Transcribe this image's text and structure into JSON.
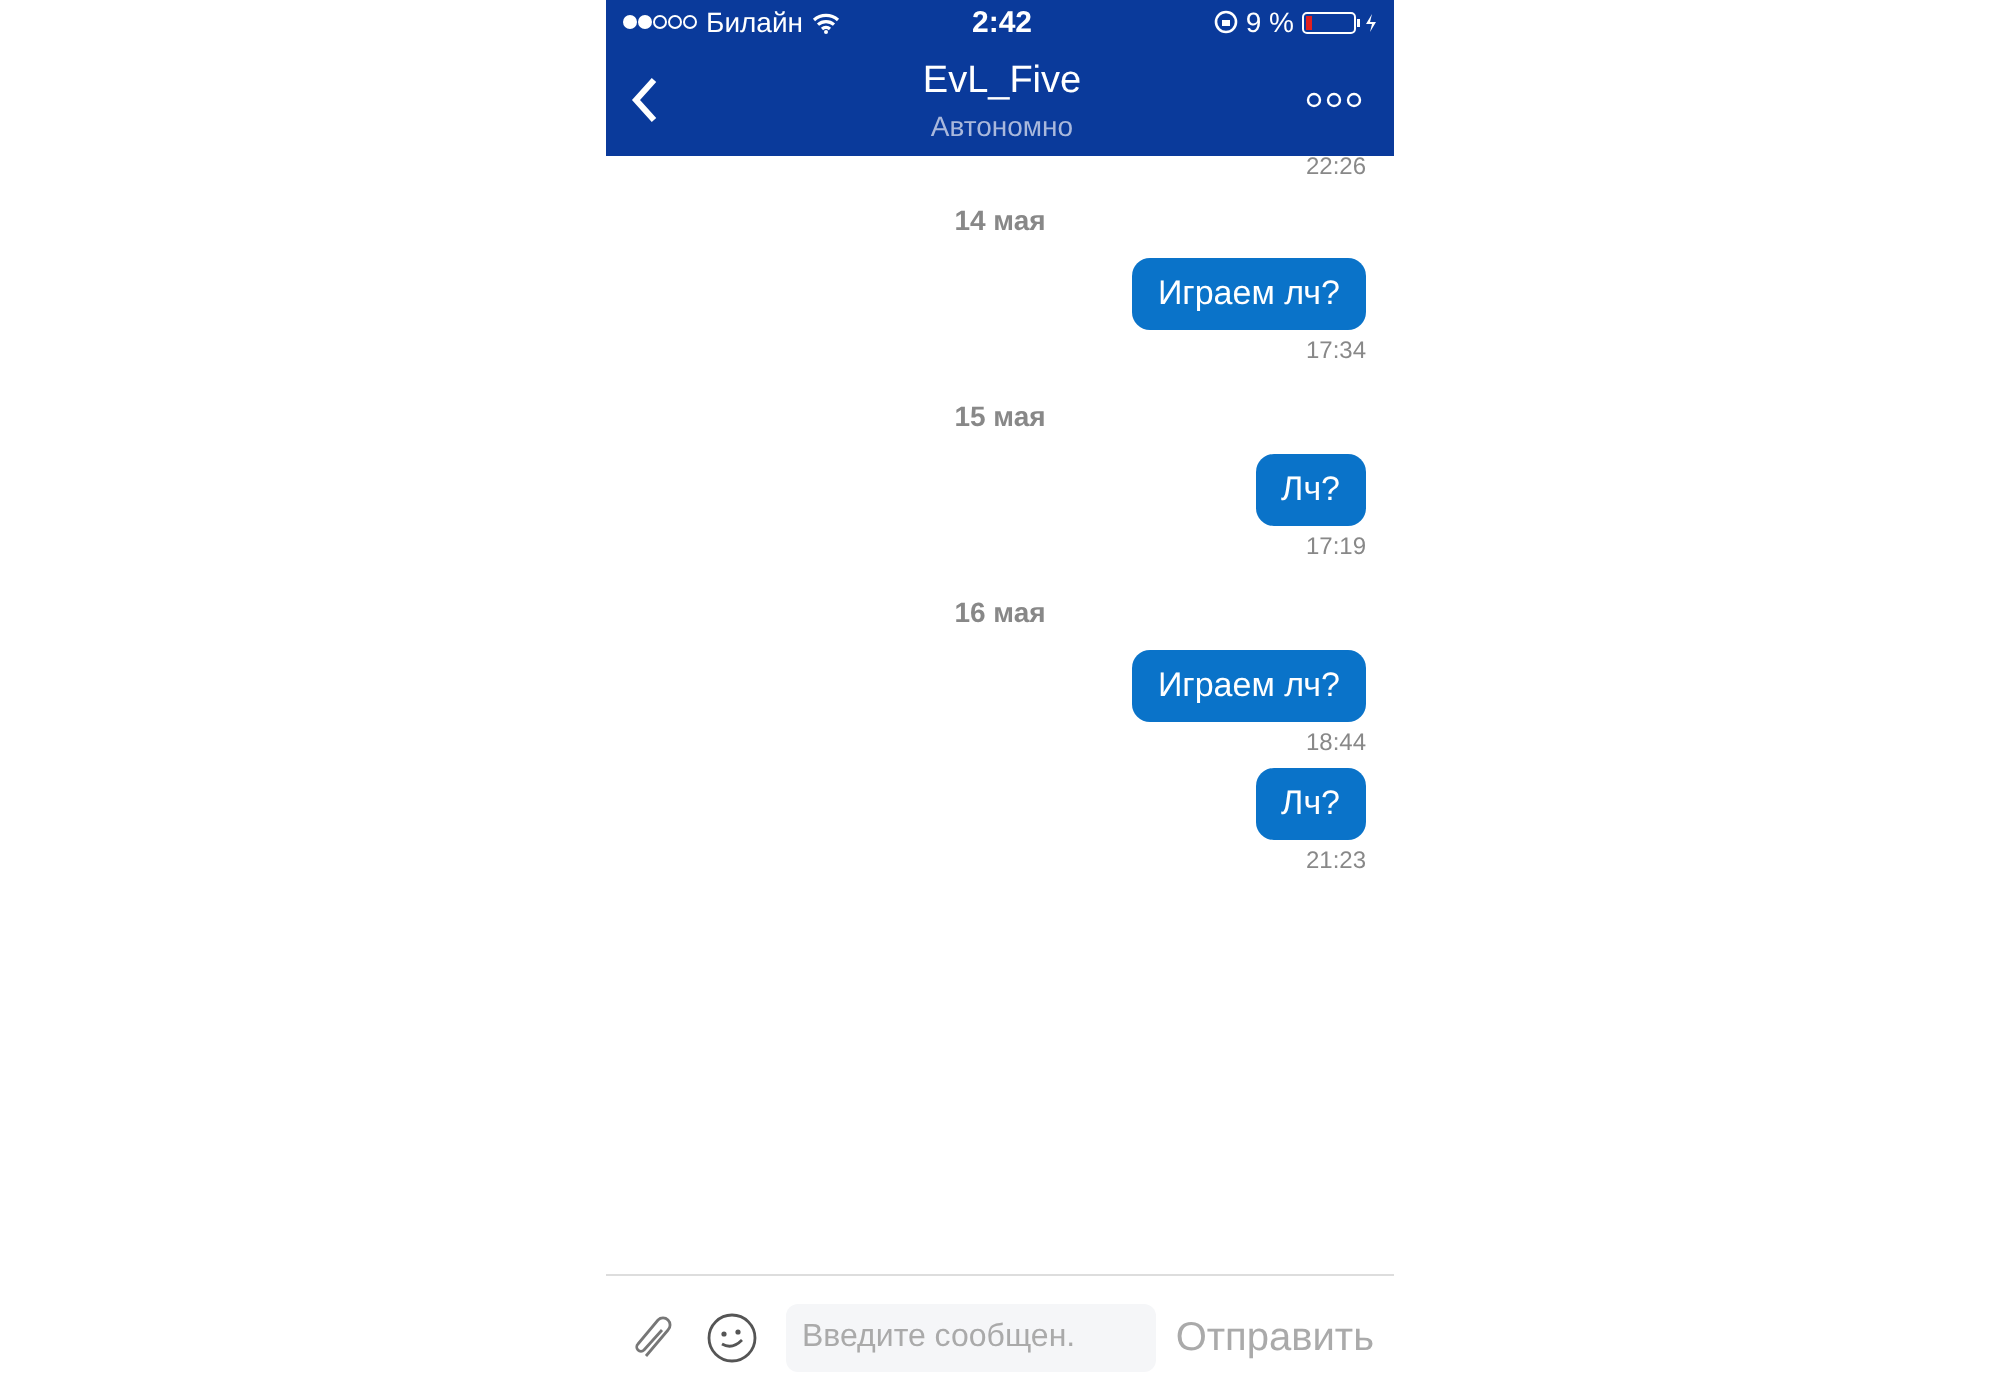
{
  "status_bar": {
    "carrier": "Билайн",
    "time": "2:42",
    "battery": "9 %"
  },
  "header": {
    "title": "EvL_Five",
    "subtitle": "Автономно"
  },
  "feed": [
    {
      "kind": "time",
      "text": "22:26"
    },
    {
      "kind": "date",
      "text": "14 мая"
    },
    {
      "kind": "message",
      "text": "Играем лч?",
      "time": "17:34"
    },
    {
      "kind": "date",
      "text": "15 мая"
    },
    {
      "kind": "message",
      "text": "Лч?",
      "time": "17:19"
    },
    {
      "kind": "date",
      "text": "16 мая"
    },
    {
      "kind": "message",
      "text": "Играем лч?",
      "time": "18:44"
    },
    {
      "kind": "message",
      "text": "Лч?",
      "time": "21:23"
    }
  ],
  "composer": {
    "placeholder": "Введите сообщен.",
    "send": "Отправить"
  }
}
